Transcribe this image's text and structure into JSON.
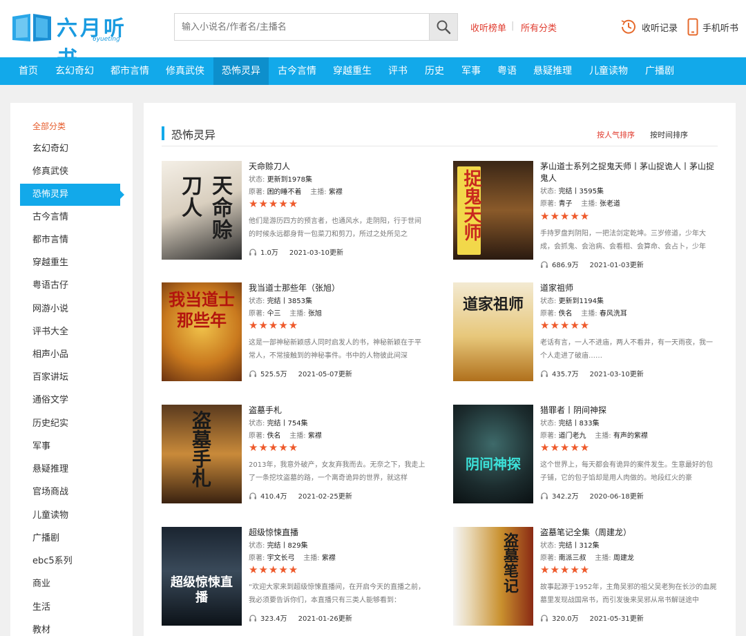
{
  "header": {
    "logo_text": "六月听书",
    "logo_sub": "6yueting",
    "search_placeholder": "输入小说名/作者名/主播名",
    "link_rank": "收听榜单",
    "link_sep": "|",
    "link_all": "所有分类",
    "history": "收听记录",
    "mobile": "手机听书"
  },
  "nav": [
    "首页",
    "玄幻奇幻",
    "都市言情",
    "修真武侠",
    "恐怖灵异",
    "古今言情",
    "穿越重生",
    "评书",
    "历史",
    "军事",
    "粤语",
    "悬疑推理",
    "儿童读物",
    "广播剧"
  ],
  "nav_active": "恐怖灵异",
  "sidebar": {
    "title": "全部分类",
    "items": [
      "玄幻奇幻",
      "修真武侠",
      "恐怖灵异",
      "古今言情",
      "都市言情",
      "穿越重生",
      "粤语古仔",
      "网游小说",
      "评书大全",
      "相声小品",
      "百家讲坛",
      "通俗文学",
      "历史纪实",
      "军事",
      "悬疑推理",
      "官场商战",
      "儿童读物",
      "广播剧",
      "ebc5系列",
      "商业",
      "生活",
      "教材"
    ],
    "active": "恐怖灵异"
  },
  "main": {
    "title": "恐怖灵异",
    "sort_popular": "按人气排序",
    "sort_time": "按时间排序"
  },
  "labels": {
    "status": "状态:",
    "author": "原著:",
    "anchor": "主播:"
  },
  "books": [
    {
      "title": "天命赊刀人",
      "status": "更新到1978集",
      "author": "困的睡不着",
      "anchor": "紫襟",
      "stars": "★★★★★",
      "desc": "他们是游历四方的预言者，也通风水，走阴阳，行于世间的时候永远都身背一包菜刀和剪刀，所过之处所见之",
      "plays": "1.0万",
      "date": "2021-03-10更新",
      "cover_text": "天命赊刀人"
    },
    {
      "title": "茅山道士系列之捉鬼天师丨茅山捉诡人丨茅山捉鬼人",
      "status": "完结丨3595集",
      "author": "青子",
      "anchor": "张老道",
      "stars": "★★★★★",
      "desc": "手持罗盘判阴阳，一把法剑定乾坤。三岁修道，少年大成，会抓鬼、会治病、会看相、会算命、会占卜，少年",
      "plays": "686.9万",
      "date": "2021-01-03更新",
      "cover_text": "捉鬼天师"
    },
    {
      "title": "我当道士那些年（张旭）",
      "status": "完结丨3853集",
      "author": "仐三",
      "anchor": "张旭",
      "stars": "★★★★★",
      "desc": "这是一部神秘新颖感人同时启发人的书，神秘新颖在于平常人，不常接触到的神秘事件。书中的人物彼此间深",
      "plays": "525.5万",
      "date": "2021-05-07更新",
      "cover_text": "我当道士那些年"
    },
    {
      "title": "道家祖师",
      "status": "更新到1194集",
      "author": "佚名",
      "anchor": "春风洗耳",
      "stars": "★★★★★",
      "desc": "老话有言，一人不进庙，两人不看井，有一天雨夜，我一个人走进了破庙……",
      "plays": "435.7万",
      "date": "2021-03-10更新",
      "cover_text": "道家祖师"
    },
    {
      "title": "盗墓手札",
      "status": "完结丨754集",
      "author": "佚名",
      "anchor": "紫襟",
      "stars": "★★★★★",
      "desc": "2013年，我意外破产，女友弃我而去。无奈之下，我走上了一条挖坟盗墓的路，一个离奇诡异的世界，就这样",
      "plays": "410.4万",
      "date": "2021-02-25更新",
      "cover_text": "盗墓手札"
    },
    {
      "title": "猎罪者丨阴间神探",
      "status": "完结丨833集",
      "author": "道门老九",
      "anchor": "有声的紫襟",
      "stars": "★★★★★",
      "desc": "这个世界上，每天都会有诡异的案件发生。生意最好的包子铺，它的包子馅却是用人肉做的。地段红火的豪",
      "plays": "342.2万",
      "date": "2020-06-18更新",
      "cover_text": "阴间神探"
    },
    {
      "title": "超级惊悚直播",
      "status": "完结丨829集",
      "author": "宇文长弓",
      "anchor": "紫襟",
      "stars": "★★★★★",
      "desc": "“欢迎大家来到超级惊悚直播间，在开启今天的直播之前，我必须要告诉你们，本直播只有三类人能够看到：",
      "plays": "323.4万",
      "date": "2021-01-26更新",
      "cover_text": "超级惊悚直播"
    },
    {
      "title": "盗墓笔记全集（周建龙）",
      "status": "完结丨312集",
      "author": "南派三叔",
      "anchor": "周建龙",
      "stars": "★★★★★",
      "desc": "故事起源于1952年，主角吴邪的祖父吴老狗在长沙的血屍墓里发现战国帛书，而引发後来吴邪从帛书解谜途中",
      "plays": "320.0万",
      "date": "2021-05-31更新",
      "cover_text": "盗墓笔记"
    }
  ]
}
